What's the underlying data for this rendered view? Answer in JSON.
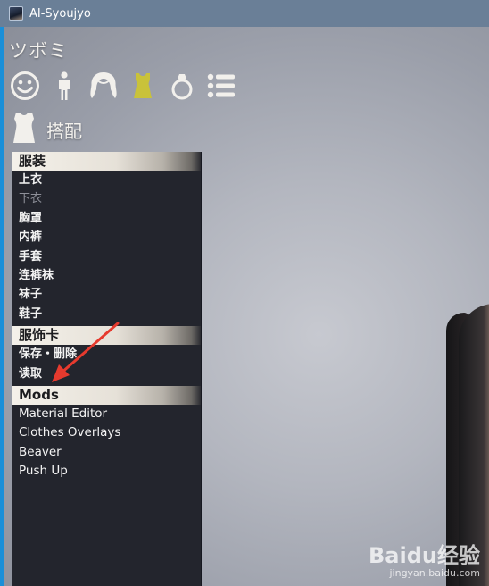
{
  "window": {
    "title": "AI-Syoujyo"
  },
  "header": {
    "app_name": "ツボミ",
    "category_icons": [
      "face-icon",
      "body-icon",
      "hair-icon",
      "clothing-icon",
      "accessory-ring-icon",
      "list-icon"
    ],
    "active_category": "clothing-icon",
    "active_color": "#c9c23a",
    "icon_color": "#f2f0ec"
  },
  "section": {
    "icon": "shirt-icon",
    "label": "搭配"
  },
  "menu": {
    "groups": [
      {
        "title": "服装",
        "items": [
          "上衣",
          "下衣",
          "胸罩",
          "内裤",
          "手套",
          "连裤袜",
          "袜子",
          "鞋子"
        ],
        "disabled_index": 1
      },
      {
        "title": "服饰卡",
        "items": [
          "保存・删除",
          "读取"
        ]
      },
      {
        "title": "Mods",
        "items": [
          "Material Editor",
          "Clothes Overlays",
          "Beaver",
          "Push Up"
        ]
      }
    ]
  },
  "annotation": {
    "arrow_color": "#e63a2e"
  },
  "watermark": {
    "brand": "Baidu经验",
    "url": "jingyan.baidu.com"
  }
}
